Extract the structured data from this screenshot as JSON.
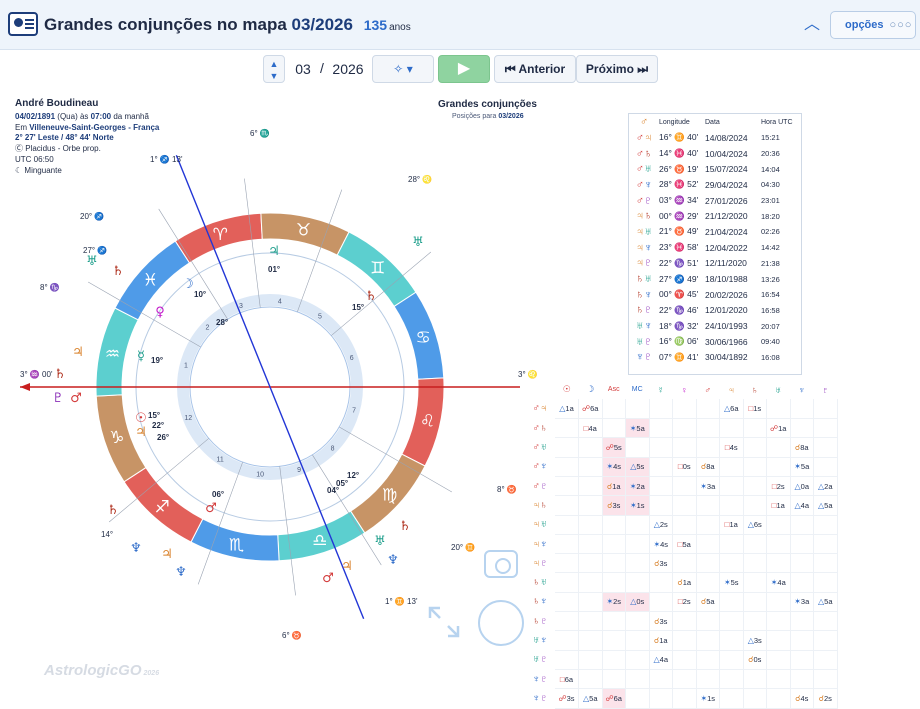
{
  "header": {
    "icon": "chart-card-icon",
    "title_prefix": "Grandes conjunções no mapa",
    "title_date": "03/2026",
    "age": "135",
    "age_unit": "anos",
    "collapse_icon": "chevron-up-icon",
    "options_label": "opções",
    "options_icon": "ellipsis-icon"
  },
  "toolbar": {
    "stepper_icon": "up-down-stepper-icon",
    "month": "03",
    "separator": "/",
    "year": "2026",
    "tools_icon": "tools-icon",
    "play_icon": "play-icon",
    "prev_label": "Anterior",
    "next_label": "Próximo"
  },
  "person": {
    "name": "André Boudineau",
    "date": "04/02/1891",
    "weekday": "(Qua) às",
    "time": "07:00",
    "period": "da manhã",
    "place_prefix": "Em",
    "place": "Villeneuve-Saint-Georges - França",
    "coords": "2° 27' Leste / 48° 44' Norte",
    "house_system": "Placidus - Orbe prop.",
    "utc": "UTC 06:50",
    "moon_phase": "Minguante"
  },
  "chart": {
    "title": "Grandes conjunções",
    "subtitle_prefix": "Posições para",
    "subtitle_date": "03/2026",
    "signs": [
      "♈",
      "♉",
      "♊",
      "♋",
      "♌",
      "♍",
      "♎",
      "♏",
      "♐",
      "♑",
      "♒",
      "♓"
    ],
    "colors": {
      "fire": "#e2605a",
      "earth": "#c79466",
      "air": "#5ccfcf",
      "water": "#4f9be8",
      "axis": "#c81e1e",
      "mc_axis": "#2236d6"
    },
    "house_labels": [
      "1",
      "2",
      "3",
      "4",
      "5",
      "6",
      "7",
      "8",
      "9",
      "10",
      "11",
      "12"
    ],
    "outer_labels": [
      {
        "text": "6° ♏"
      },
      {
        "text": "1° ♐ 13'"
      },
      {
        "text": "28° ♌"
      },
      {
        "text": "20° ♐"
      },
      {
        "text": "27° ♐"
      },
      {
        "text": "8° ♑"
      },
      {
        "text": "3° ♒ 00'"
      },
      {
        "text": "8° ♉"
      },
      {
        "text": "3° ♌ 00'"
      },
      {
        "text": "14°"
      },
      {
        "text": "20° ♊"
      },
      {
        "text": "6° ♉"
      },
      {
        "text": "1° ♊ 13'"
      }
    ],
    "inner_labels": [
      {
        "text": "01°"
      },
      {
        "text": "10°"
      },
      {
        "text": "28°"
      },
      {
        "text": "15°"
      },
      {
        "text": "19°"
      },
      {
        "text": "15°"
      },
      {
        "text": "22°"
      },
      {
        "text": "26°"
      },
      {
        "text": "06°"
      },
      {
        "text": "12°"
      },
      {
        "text": "05°"
      },
      {
        "text": "04°"
      }
    ]
  },
  "conjunctions": {
    "header_icon": "mars-icon",
    "headers": [
      "Longitude",
      "Data",
      "Hora UTC"
    ],
    "rows": [
      {
        "pair": "♂♃",
        "lon": "16° ♊ 40'",
        "date": "14/08/2024",
        "utc": "15:21"
      },
      {
        "pair": "♂♄",
        "lon": "14° ♓ 40'",
        "date": "10/04/2024",
        "utc": "20:36"
      },
      {
        "pair": "♂♅",
        "lon": "26° ♉ 19'",
        "date": "15/07/2024",
        "utc": "14:04"
      },
      {
        "pair": "♂♆",
        "lon": "28° ♓ 52'",
        "date": "29/04/2024",
        "utc": "04:30"
      },
      {
        "pair": "♂♇",
        "lon": "03° ♒ 34'",
        "date": "27/01/2026",
        "utc": "23:01"
      },
      {
        "pair": "♃♄",
        "lon": "00° ♒ 29'",
        "date": "21/12/2020",
        "utc": "18:20"
      },
      {
        "pair": "♃♅",
        "lon": "21° ♉ 49'",
        "date": "21/04/2024",
        "utc": "02:26"
      },
      {
        "pair": "♃♆",
        "lon": "23° ♓ 58'",
        "date": "12/04/2022",
        "utc": "14:42"
      },
      {
        "pair": "♃♇",
        "lon": "22° ♑ 51'",
        "date": "12/11/2020",
        "utc": "21:38"
      },
      {
        "pair": "♄♅",
        "lon": "27° ♐ 49'",
        "date": "18/10/1988",
        "utc": "13:26"
      },
      {
        "pair": "♄♆",
        "lon": "00° ♈ 45'",
        "date": "20/02/2026",
        "utc": "16:54"
      },
      {
        "pair": "♄♇",
        "lon": "22° ♑ 46'",
        "date": "12/01/2020",
        "utc": "16:58"
      },
      {
        "pair": "♅♆",
        "lon": "18° ♑ 32'",
        "date": "24/10/1993",
        "utc": "20:07"
      },
      {
        "pair": "♅♇",
        "lon": "16° ♍ 06'",
        "date": "30/06/1966",
        "utc": "09:40"
      },
      {
        "pair": "♆♇",
        "lon": "07° ♊ 41'",
        "date": "30/04/1892",
        "utc": "16:08"
      }
    ]
  },
  "aspects": {
    "columns": [
      "☉",
      "☽",
      "Asc",
      "MC",
      "☿",
      "♀",
      "♂",
      "♃",
      "♄",
      "♅",
      "♆",
      "♇"
    ],
    "rows": [
      {
        "label": "♂♃",
        "cells": [
          "△1a",
          "☍6a",
          "",
          "",
          "",
          "",
          "",
          "△6a",
          "□1s",
          "",
          "",
          ""
        ]
      },
      {
        "label": "♂♄",
        "cells": [
          "",
          "□4a",
          "",
          "✶5a",
          "",
          "",
          "",
          "",
          "",
          "☍1a",
          "",
          ""
        ]
      },
      {
        "label": "♂♅",
        "cells": [
          "",
          "",
          "☍5s",
          "",
          "",
          "",
          "",
          "□4s",
          "",
          "",
          "☌8a",
          ""
        ]
      },
      {
        "label": "♂♆",
        "cells": [
          "",
          "",
          "✶4s",
          "△5s",
          "",
          "□0s",
          "☌8a",
          "",
          "",
          "",
          "✶5a",
          ""
        ]
      },
      {
        "label": "♂♇",
        "cells": [
          "",
          "",
          "☌1a",
          "✶2a",
          "",
          "",
          "✶3a",
          "",
          "",
          "□2s",
          "△0a",
          "△2a"
        ]
      },
      {
        "label": "♃♄",
        "cells": [
          "",
          "",
          "☌3s",
          "✶1s",
          "",
          "",
          "",
          "",
          "",
          "□1a",
          "△4a",
          "△5a"
        ]
      },
      {
        "label": "♃♅",
        "cells": [
          "",
          "",
          "",
          "",
          "△2s",
          "",
          "",
          "□1a",
          "△6s",
          "",
          "",
          ""
        ]
      },
      {
        "label": "♃♆",
        "cells": [
          "",
          "",
          "",
          "",
          "✶4s",
          "□5a",
          "",
          "",
          "",
          "",
          "",
          ""
        ]
      },
      {
        "label": "♃♇",
        "cells": [
          "",
          "",
          "",
          "",
          "☌3s",
          "",
          "",
          "",
          "",
          "",
          "",
          ""
        ]
      },
      {
        "label": "♄♅",
        "cells": [
          "",
          "",
          "",
          "",
          "",
          "☌1a",
          "",
          "✶5s",
          "",
          "✶4a",
          "",
          ""
        ]
      },
      {
        "label": "♄♆",
        "cells": [
          "",
          "",
          "✶2s",
          "△0s",
          "",
          "□2s",
          "☌5a",
          "",
          "",
          "",
          "✶3a",
          "△5a"
        ]
      },
      {
        "label": "♄♇",
        "cells": [
          "",
          "",
          "",
          "",
          "☌3s",
          "",
          "",
          "",
          "",
          "",
          "",
          ""
        ]
      },
      {
        "label": "♅♆",
        "cells": [
          "",
          "",
          "",
          "",
          "☌1a",
          "",
          "",
          "",
          "△3s",
          "",
          "",
          ""
        ]
      },
      {
        "label": "♅♇",
        "cells": [
          "",
          "",
          "",
          "",
          "△4a",
          "",
          "",
          "",
          "☌0s",
          "",
          "",
          ""
        ]
      },
      {
        "label": "♆♇",
        "cells": [
          "□6a",
          "",
          "",
          "",
          "",
          "",
          "",
          "",
          "",
          "",
          "",
          ""
        ]
      },
      {
        "label": "♆♇",
        "cells": [
          "☍3s",
          "△5a",
          "☍6a",
          "",
          "",
          "",
          "✶1s",
          "",
          "",
          "",
          "☌4s",
          "☌2s"
        ]
      }
    ]
  },
  "footer": {
    "camera_icon": "camera-icon",
    "expand_icon": "expand-icon",
    "magic_icon": "sparkle-icon",
    "logo": "AstrologicGO",
    "logo_year": "2026"
  }
}
